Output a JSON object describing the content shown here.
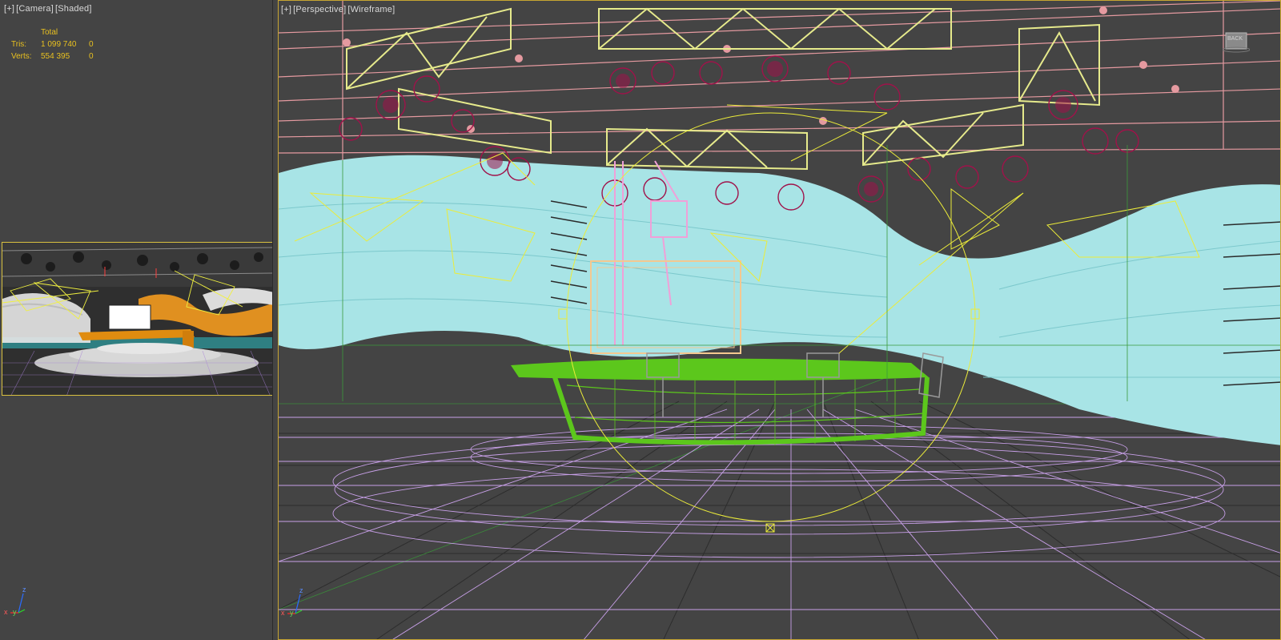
{
  "camera_viewport": {
    "label_parts": [
      "[+]",
      "[Camera]",
      "[Shaded]"
    ],
    "stats": {
      "header": "Total",
      "rows": [
        {
          "label": "Tris:",
          "value": "1 099 740",
          "extra": "0"
        },
        {
          "label": "Verts:",
          "value": "554 395",
          "extra": "0"
        }
      ]
    },
    "axis": {
      "x": "x",
      "y": "y",
      "z": "z"
    }
  },
  "perspective_viewport": {
    "label_parts": [
      "[+]",
      "[Perspective]",
      "[Wireframe]"
    ],
    "viewcube_label": "BACK",
    "axis": {
      "x": "x",
      "y": "y",
      "z": "z"
    }
  },
  "colors": {
    "viewport_bg": "#444444",
    "active_border": "#c7a532",
    "stats_text": "#e8c020",
    "truss": "#e6ea8c",
    "lights": "#a0124a",
    "rails": "#e59aa0",
    "wall": "#a8e4e6",
    "desk": "#5cc71c",
    "stage": "#c8a0e8",
    "grid": "#2b2b2b",
    "light_gizmo": "#ecec3a"
  }
}
